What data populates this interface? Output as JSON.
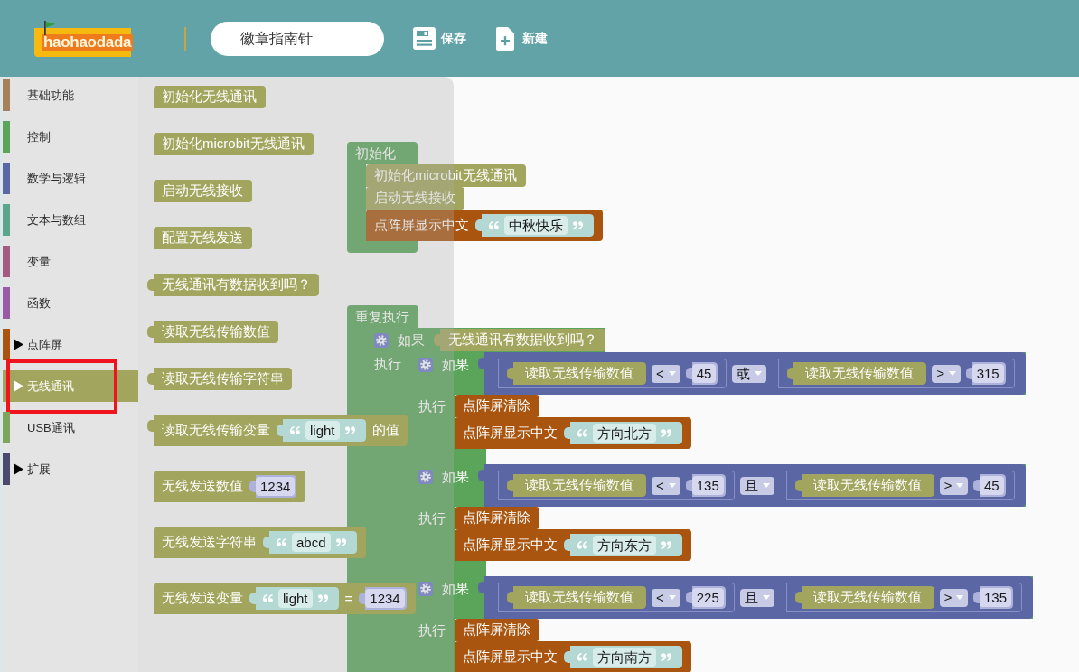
{
  "header": {
    "logo_text": "haohaodada",
    "project_name": "徽章指南针",
    "actions": [
      {
        "kind": "save",
        "label": "保存"
      },
      {
        "kind": "new",
        "label": "新建"
      }
    ]
  },
  "sidebar": {
    "items": [
      {
        "label": "基础功能",
        "color": "#a6805a",
        "expandable": false,
        "selected": false,
        "highlighted": false
      },
      {
        "label": "控制",
        "color": "#5ba55b",
        "expandable": false,
        "selected": false,
        "highlighted": false
      },
      {
        "label": "数学与逻辑",
        "color": "#5b67a5",
        "expandable": false,
        "selected": false,
        "highlighted": false
      },
      {
        "label": "文本与数组",
        "color": "#5ba58c",
        "expandable": false,
        "selected": false,
        "highlighted": false
      },
      {
        "label": "变量",
        "color": "#a55b80",
        "expandable": false,
        "selected": false,
        "highlighted": false
      },
      {
        "label": "函数",
        "color": "#995ba5",
        "expandable": false,
        "selected": false,
        "highlighted": false
      },
      {
        "label": "点阵屏",
        "color": "#a9550f",
        "expandable": true,
        "selected": false,
        "highlighted": false
      },
      {
        "label": "无线通讯",
        "color": "#a2a55d",
        "expandable": true,
        "selected": true,
        "highlighted": true
      },
      {
        "label": "USB通讯",
        "color": "#7ea55b",
        "expandable": false,
        "selected": false,
        "highlighted": false
      },
      {
        "label": "扩展",
        "color": "#4b4a6c",
        "expandable": true,
        "selected": false,
        "highlighted": false
      }
    ]
  },
  "flyout": {
    "blocks": [
      {
        "kind": "statement",
        "color": "#a2a55d",
        "parts": [
          {
            "kind": "label",
            "text": "初始化无线通讯"
          }
        ]
      },
      {
        "kind": "statement",
        "color": "#a2a55d",
        "parts": [
          {
            "kind": "label",
            "text": "初始化microbit无线通讯"
          }
        ]
      },
      {
        "kind": "statement",
        "color": "#a2a55d",
        "parts": [
          {
            "kind": "label",
            "text": "启动无线接收"
          }
        ]
      },
      {
        "kind": "statement",
        "color": "#a2a55d",
        "parts": [
          {
            "kind": "label",
            "text": "配置无线发送"
          }
        ]
      },
      {
        "kind": "reporter",
        "color": "#a2a55d",
        "parts": [
          {
            "kind": "label",
            "text": "无线通讯有数据收到吗？"
          }
        ]
      },
      {
        "kind": "reporter",
        "color": "#a2a55d",
        "parts": [
          {
            "kind": "label",
            "text": "读取无线传输数值"
          }
        ]
      },
      {
        "kind": "reporter",
        "color": "#a2a55d",
        "parts": [
          {
            "kind": "label",
            "text": "读取无线传输字符串"
          }
        ]
      },
      {
        "kind": "reporter",
        "color": "#a2a55d",
        "parts": [
          {
            "kind": "label",
            "text": "读取无线传输变量"
          },
          {
            "kind": "text",
            "text": "light"
          },
          {
            "kind": "label",
            "text": "的值"
          }
        ]
      },
      {
        "kind": "statement",
        "color": "#a2a55d",
        "parts": [
          {
            "kind": "label",
            "text": "无线发送数值"
          },
          {
            "kind": "number",
            "text": "1234"
          }
        ]
      },
      {
        "kind": "statement",
        "color": "#a2a55d",
        "parts": [
          {
            "kind": "label",
            "text": "无线发送字符串"
          },
          {
            "kind": "text",
            "text": "abcd"
          }
        ]
      },
      {
        "kind": "statement",
        "color": "#a2a55d",
        "parts": [
          {
            "kind": "label",
            "text": "无线发送变量"
          },
          {
            "kind": "text",
            "text": "light"
          },
          {
            "kind": "label",
            "text": "="
          },
          {
            "kind": "number",
            "text": "1234"
          }
        ]
      }
    ]
  },
  "workspace": {
    "stacks": [
      {
        "kind": "container",
        "label": "初始化",
        "body": [
          {
            "kind": "statement",
            "color": "#a2a55d",
            "parts": [
              {
                "kind": "label",
                "text": "初始化microbit无线通讯"
              }
            ]
          },
          {
            "kind": "statement",
            "color": "#a2a55d",
            "parts": [
              {
                "kind": "label",
                "text": "启动无线接收"
              }
            ]
          },
          {
            "kind": "statement",
            "color": "#a9550f",
            "parts": [
              {
                "kind": "label",
                "text": "点阵屏显示中文"
              },
              {
                "kind": "text",
                "text": "中秋快乐"
              }
            ]
          }
        ]
      },
      {
        "kind": "container",
        "label": "重复执行",
        "body": [
          {
            "kind": "if",
            "label": "如果",
            "condition": {
              "kind": "reporter",
              "color": "#a2a55d",
              "parts": [
                {
                  "kind": "label",
                  "text": "无线通讯有数据收到吗？"
                }
              ]
            },
            "do_label": "执行",
            "body": [
              {
                "kind": "if",
                "label": "如果",
                "condition": {
                  "kind": "operator",
                  "color": "#5b67a5",
                  "parts": [
                    {
                      "kind": "operator",
                      "color": "#5b67a5",
                      "parts": [
                        {
                          "kind": "reporter",
                          "color": "#a2a55d",
                          "parts": [
                            {
                              "kind": "label",
                              "text": "读取无线传输数值"
                            }
                          ]
                        },
                        {
                          "kind": "dropdown",
                          "text": "<"
                        },
                        {
                          "kind": "number",
                          "text": "45"
                        }
                      ]
                    },
                    {
                      "kind": "dropdown",
                      "text": "或"
                    },
                    {
                      "kind": "operator",
                      "color": "#5b67a5",
                      "parts": [
                        {
                          "kind": "reporter",
                          "color": "#a2a55d",
                          "parts": [
                            {
                              "kind": "label",
                              "text": "读取无线传输数值"
                            }
                          ]
                        },
                        {
                          "kind": "dropdown",
                          "text": "≥"
                        },
                        {
                          "kind": "number",
                          "text": "315"
                        }
                      ]
                    }
                  ]
                },
                "do_label": "执行",
                "body": [
                  {
                    "kind": "statement",
                    "color": "#a9550f",
                    "parts": [
                      {
                        "kind": "label",
                        "text": "点阵屏清除"
                      }
                    ]
                  },
                  {
                    "kind": "statement",
                    "color": "#a9550f",
                    "parts": [
                      {
                        "kind": "label",
                        "text": "点阵屏显示中文"
                      },
                      {
                        "kind": "text",
                        "text": "方向北方"
                      }
                    ]
                  }
                ]
              },
              {
                "kind": "if",
                "label": "如果",
                "condition": {
                  "kind": "operator",
                  "color": "#5b67a5",
                  "parts": [
                    {
                      "kind": "operator",
                      "color": "#5b67a5",
                      "parts": [
                        {
                          "kind": "reporter",
                          "color": "#a2a55d",
                          "parts": [
                            {
                              "kind": "label",
                              "text": "读取无线传输数值"
                            }
                          ]
                        },
                        {
                          "kind": "dropdown",
                          "text": "<"
                        },
                        {
                          "kind": "number",
                          "text": "135"
                        }
                      ]
                    },
                    {
                      "kind": "dropdown",
                      "text": "且"
                    },
                    {
                      "kind": "operator",
                      "color": "#5b67a5",
                      "parts": [
                        {
                          "kind": "reporter",
                          "color": "#a2a55d",
                          "parts": [
                            {
                              "kind": "label",
                              "text": "读取无线传输数值"
                            }
                          ]
                        },
                        {
                          "kind": "dropdown",
                          "text": "≥"
                        },
                        {
                          "kind": "number",
                          "text": "45"
                        }
                      ]
                    }
                  ]
                },
                "do_label": "执行",
                "body": [
                  {
                    "kind": "statement",
                    "color": "#a9550f",
                    "parts": [
                      {
                        "kind": "label",
                        "text": "点阵屏清除"
                      }
                    ]
                  },
                  {
                    "kind": "statement",
                    "color": "#a9550f",
                    "parts": [
                      {
                        "kind": "label",
                        "text": "点阵屏显示中文"
                      },
                      {
                        "kind": "text",
                        "text": "方向东方"
                      }
                    ]
                  }
                ]
              },
              {
                "kind": "if",
                "label": "如果",
                "condition": {
                  "kind": "operator",
                  "color": "#5b67a5",
                  "parts": [
                    {
                      "kind": "operator",
                      "color": "#5b67a5",
                      "parts": [
                        {
                          "kind": "reporter",
                          "color": "#a2a55d",
                          "parts": [
                            {
                              "kind": "label",
                              "text": "读取无线传输数值"
                            }
                          ]
                        },
                        {
                          "kind": "dropdown",
                          "text": "<"
                        },
                        {
                          "kind": "number",
                          "text": "225"
                        }
                      ]
                    },
                    {
                      "kind": "dropdown",
                      "text": "且"
                    },
                    {
                      "kind": "operator",
                      "color": "#5b67a5",
                      "parts": [
                        {
                          "kind": "reporter",
                          "color": "#a2a55d",
                          "parts": [
                            {
                              "kind": "label",
                              "text": "读取无线传输数值"
                            }
                          ]
                        },
                        {
                          "kind": "dropdown",
                          "text": "≥"
                        },
                        {
                          "kind": "number",
                          "text": "135"
                        }
                      ]
                    }
                  ]
                },
                "do_label": "执行",
                "body": [
                  {
                    "kind": "statement",
                    "color": "#a9550f",
                    "parts": [
                      {
                        "kind": "label",
                        "text": "点阵屏清除"
                      }
                    ]
                  },
                  {
                    "kind": "statement",
                    "color": "#a9550f",
                    "parts": [
                      {
                        "kind": "label",
                        "text": "点阵屏显示中文"
                      },
                      {
                        "kind": "text",
                        "text": "方向南方"
                      }
                    ]
                  }
                ]
              }
            ]
          }
        ]
      }
    ]
  }
}
